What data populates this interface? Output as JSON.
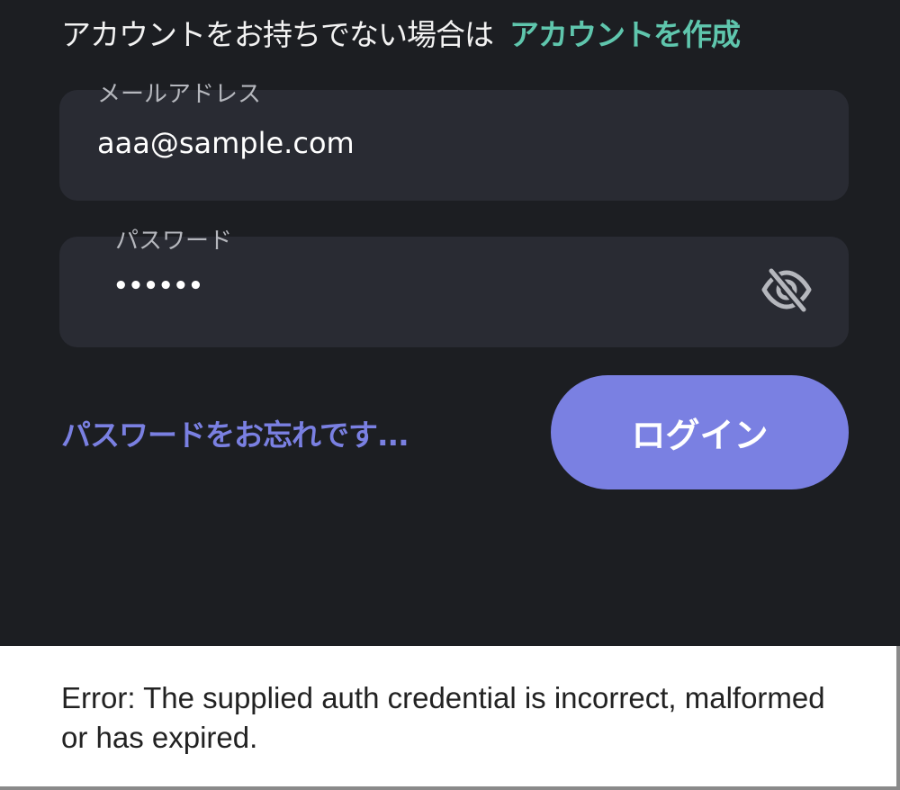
{
  "signup": {
    "prompt": "アカウントをお持ちでない場合は",
    "link": "アカウントを作成"
  },
  "email": {
    "label": "メールアドレス",
    "value": "aaa@sample.com"
  },
  "password": {
    "label": "パスワード",
    "value": "••••••",
    "toggle_icon": "eye-slash-icon"
  },
  "forgot_password": "パスワードをお忘れです...",
  "login_button": "ログイン",
  "error": {
    "message": "Error: The supplied auth credential is incorrect, malformed or has expired."
  },
  "colors": {
    "background": "#1c1e22",
    "field": "#292b33",
    "accent_green": "#5fc6ad",
    "accent_purple": "#7a80e2",
    "error_panel": "#ffffff"
  }
}
